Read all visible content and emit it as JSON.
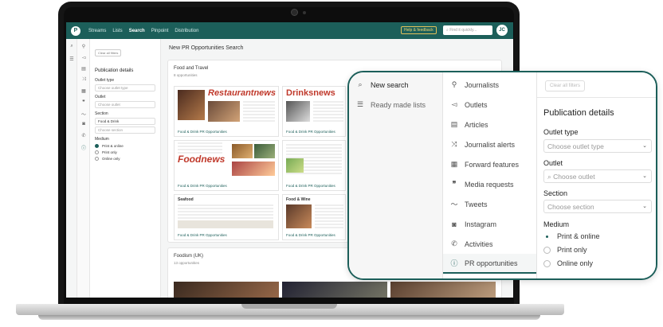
{
  "app": {
    "nav": [
      "Streams",
      "Lists",
      "Search",
      "Pinpoint",
      "Distribution"
    ],
    "active_nav": "Search",
    "feedback": "Help & feedback",
    "quick_find": "Find it quickly...",
    "avatar": "JC",
    "logo": "P"
  },
  "filters": {
    "clear": "Clear all filters",
    "heading": "Publication details",
    "outlet_type_label": "Outlet type",
    "outlet_type_placeholder": "Choose outlet type",
    "outlet_label": "Outlet",
    "outlet_placeholder": "Choose outlet",
    "section_label": "Section",
    "section_value": "Food & Drink",
    "section_placeholder": "Choose section",
    "medium_label": "Medium",
    "medium_options": [
      "Print & online",
      "Print only",
      "Online only"
    ],
    "medium_selected": "Print & online"
  },
  "main": {
    "title": "New PR Opportunities Search",
    "groups": [
      {
        "title": "Food and Travel",
        "subtitle": "8 opportunities"
      },
      {
        "title": "Foodism (UK)",
        "subtitle": "13 opportunities"
      }
    ],
    "thumb_label": "Food & Drink PR Opportunities",
    "thumb_headlines": [
      "Restaurantnews",
      "Drinksnews",
      "Foodnews",
      "Seafood",
      "Food & Wine"
    ]
  },
  "zoom": {
    "col1": [
      "New search",
      "Ready made lists"
    ],
    "col2": [
      "Journalists",
      "Outlets",
      "Articles",
      "Journalist alerts",
      "Forward features",
      "Media requests",
      "Tweets",
      "Instagram",
      "Activities",
      "PR opportunities"
    ],
    "clear": "Clear all filters",
    "heading": "Publication details",
    "outlet_type_label": "Outlet type",
    "outlet_type_placeholder": "Choose outlet type",
    "outlet_label": "Outlet",
    "outlet_placeholder": "Choose outlet",
    "section_label": "Section",
    "section_placeholder": "Choose section",
    "medium_label": "Medium",
    "medium_options": [
      "Print & online",
      "Print only",
      "Online only"
    ],
    "medium_selected": "Print & online"
  },
  "colors": {
    "brand": "#1c5f5a",
    "accent_feedback": "#e3c15a",
    "headline_red": "#c0392b"
  },
  "icons": [
    "search-icon",
    "list-icon",
    "person-icon",
    "megaphone-icon",
    "document-icon",
    "shuffle-icon",
    "calendar-icon",
    "quote-icon",
    "bird-icon",
    "instagram-icon",
    "phone-icon",
    "info-circle-icon",
    "chevron-down-icon"
  ]
}
